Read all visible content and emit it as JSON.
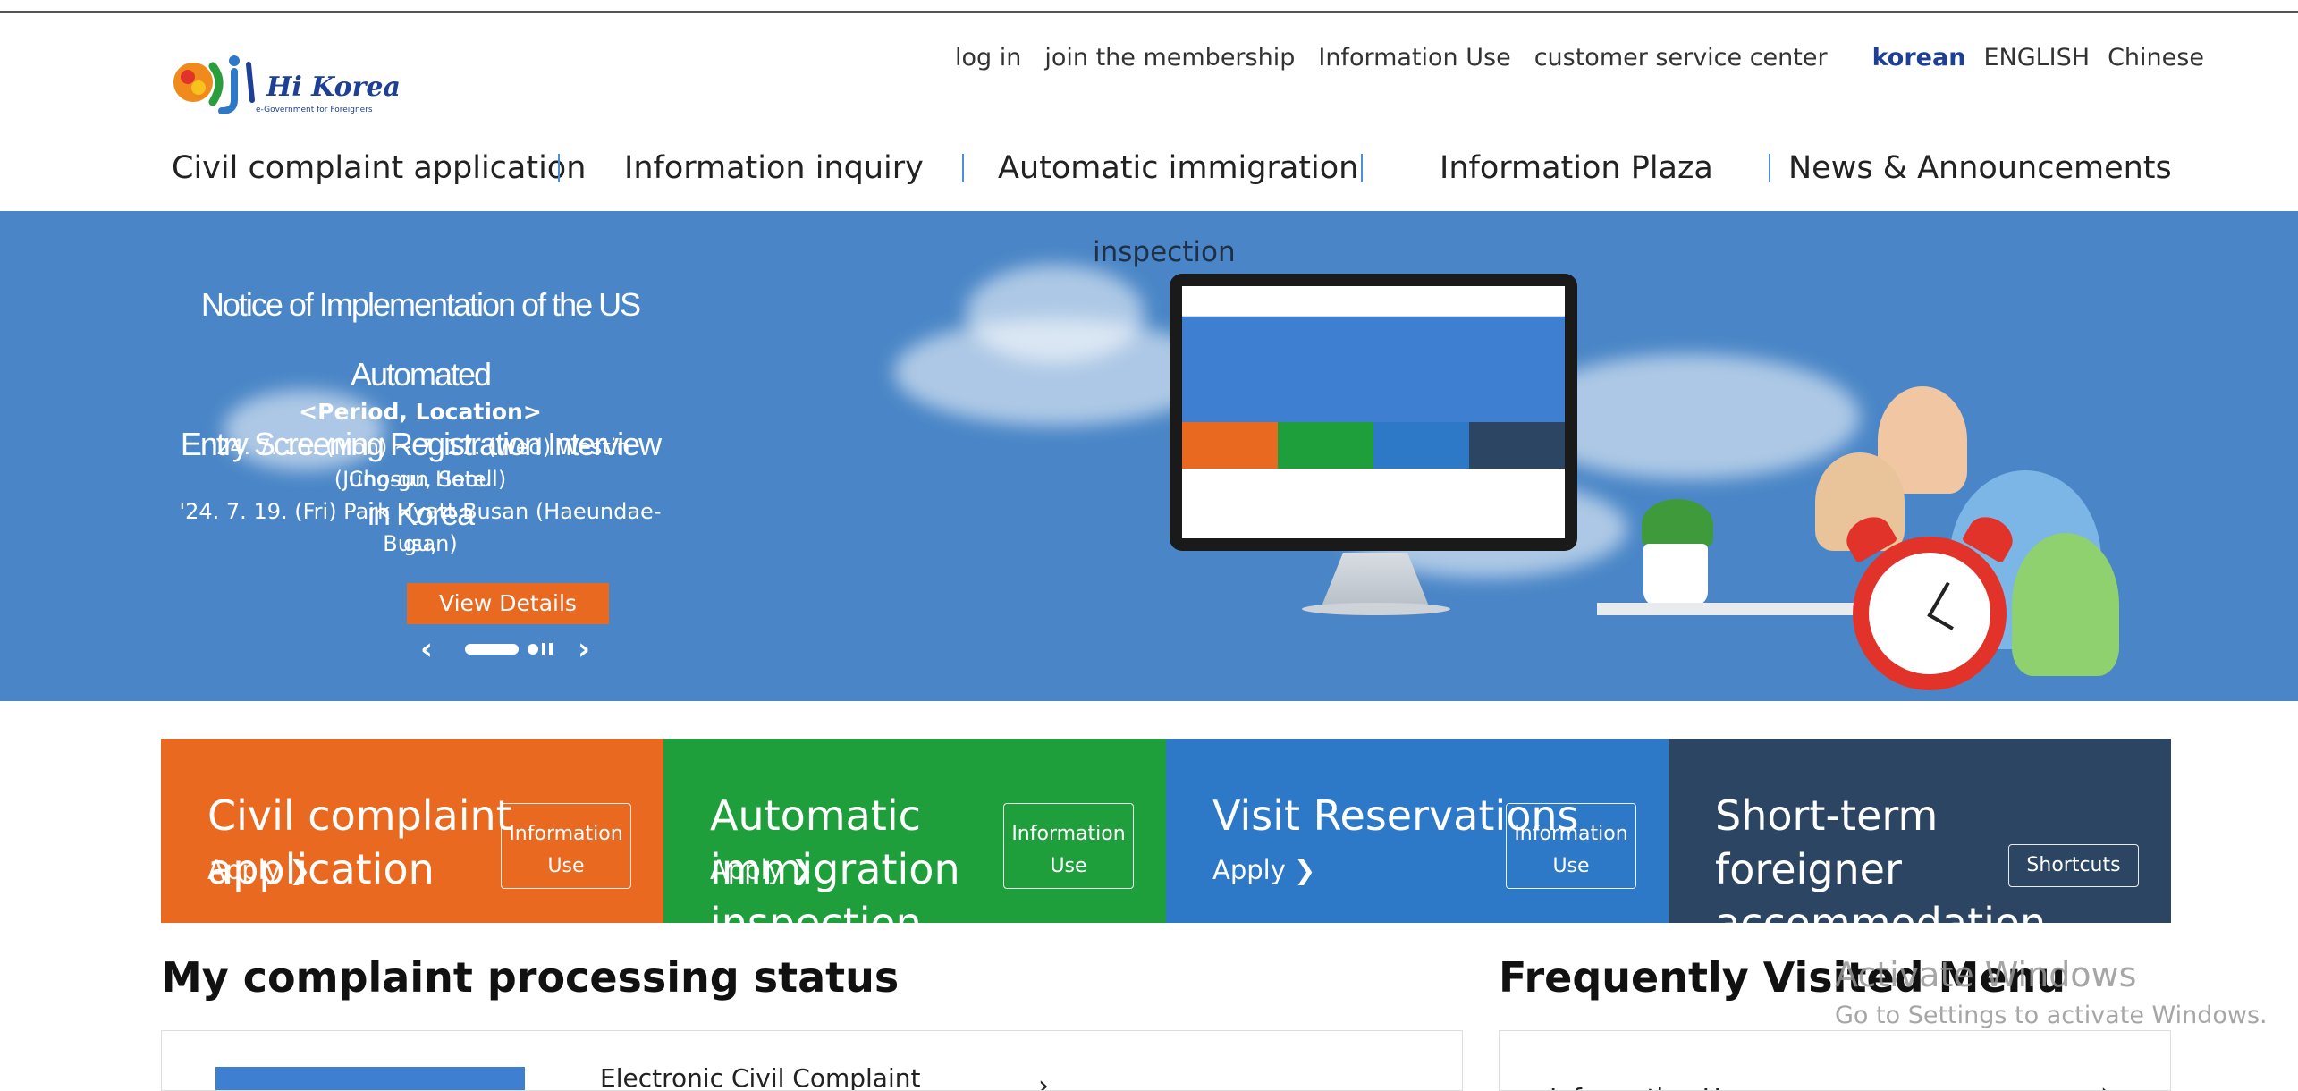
{
  "logo": {
    "text": "Hi Korea",
    "subtitle": "e-Government for Foreigners"
  },
  "util_nav": {
    "links": [
      "log in",
      "join the membership",
      "Information Use",
      "customer service center"
    ],
    "languages": [
      "korean",
      "ENGLISH",
      "Chinese"
    ],
    "active_language": "korean"
  },
  "gnb": {
    "items": [
      "Civil complaint application",
      "Information inquiry",
      "Automatic immigration",
      "Information Plaza",
      "News & Announcements"
    ],
    "overflow_text": "inspection"
  },
  "hero": {
    "title_line1": "Notice of Implementation of the US Automated",
    "title_line2": "Entry Screening Registration Interview in Korea",
    "period_heading": "<Period, Location>",
    "line1": "'24. 7. 15. (Mon) ~ 7. 17. (Wed) Westin Chosun Hotel",
    "line2": "(Jung-gu, Seoul)",
    "line3": "'24. 7. 19. (Fri) Park Hyatt Busan (Haeundae-gu,",
    "line4": "Busan)",
    "button_label": "View Details",
    "prev_arrow": "‹",
    "next_arrow": "›"
  },
  "tiles": [
    {
      "title": "Civil complaint application",
      "apply": "Apply",
      "apply_arrow": "❯",
      "button": "Information Use",
      "color": "#e8691f"
    },
    {
      "title": "Automatic immigration inspection",
      "apply": "Apply",
      "apply_arrow": "❯",
      "button": "Information Use",
      "color": "#1f9e3c"
    },
    {
      "title": "Visit Reservations",
      "apply": "Apply",
      "apply_arrow": "❯",
      "button": "Information Use",
      "color": "#2e78c8"
    },
    {
      "title": "Short-term foreigner accommodation report",
      "apply": "",
      "apply_arrow": "",
      "button": "Shortcuts",
      "color": "#2b4562"
    }
  ],
  "status_section": {
    "title": "My complaint processing status",
    "item_text": "Electronic Civil Complaint",
    "chevron": "›"
  },
  "frequent_section": {
    "title": "Frequently Visited Menu",
    "item_text": "Information Use",
    "chevron": "›"
  },
  "watermark": {
    "line1": "Activate Windows",
    "line2": "Go to Settings to activate Windows."
  },
  "colors": {
    "hero_bg": "#4a86c7",
    "accent_blue": "#1d3f95",
    "orange": "#e8691f",
    "green": "#1f9e3c",
    "blue": "#2e78c8",
    "navy": "#2b4562"
  }
}
